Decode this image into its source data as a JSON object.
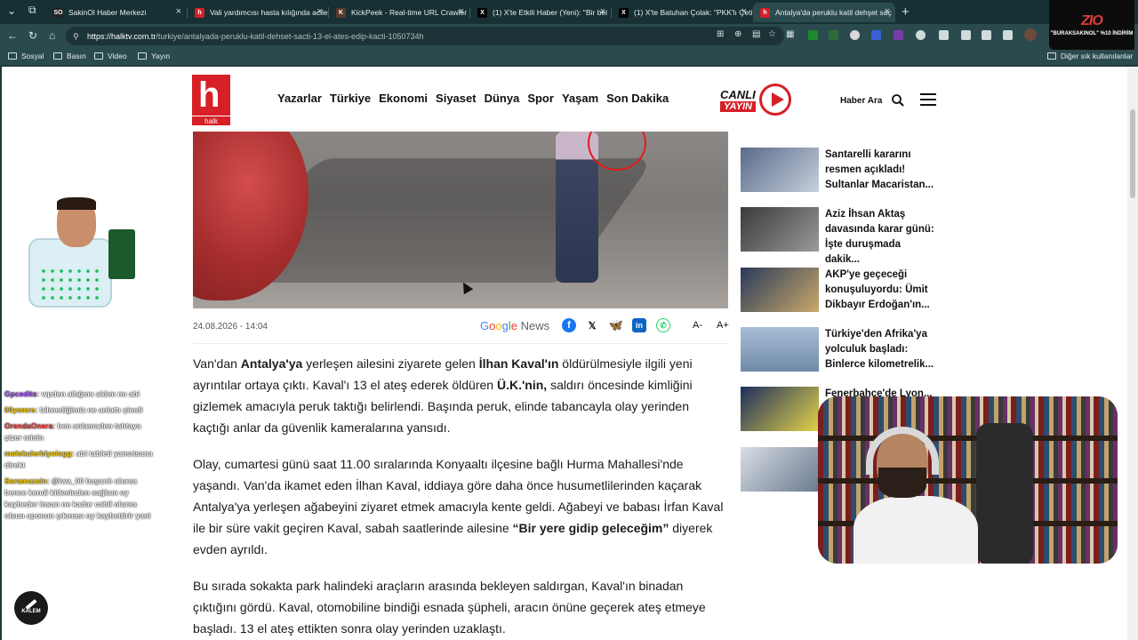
{
  "browser": {
    "tabs": [
      {
        "title": "SakinOl Haber Merkezi",
        "favicon": "SO",
        "color": "#222222"
      },
      {
        "title": "Vali yardımcısı hasta kılığında acile",
        "favicon": "h",
        "color": "#d61f26"
      },
      {
        "title": "KickPeek - Real-time URL Crawler",
        "favicon": "K",
        "color": "#5a3a2a"
      },
      {
        "title": "(1) X'te Etkili Haber (Yeni): \"Bir bel",
        "favicon": "X",
        "color": "#000000"
      },
      {
        "title": "(1) X'te Batuhan Çolak: \"PKK'lı Çeti",
        "favicon": "X",
        "color": "#000000"
      },
      {
        "title": "Antalya'da peruklu katil dehşet saç",
        "favicon": "h",
        "color": "#d61f26"
      }
    ],
    "url_host": "https://halktv.com.tr",
    "url_path": "/turkiye/antalyada-peruklu-katil-dehset-sacti-13-el-ates-edip-kacti-1050734h",
    "bookmarks": [
      "Sosyal",
      "Basın",
      "Video",
      "Yayın"
    ],
    "other_bookmarks": "Diğer sık kullanılanlar",
    "stream_badge_brand": "ZIO",
    "stream_badge_code": "\"BURAKSAKINOL\" %10 İNDİRİM"
  },
  "site": {
    "logo_letter": "h",
    "logo_sub": "halk",
    "nav": [
      "Yazarlar",
      "Türkiye",
      "Ekonomi",
      "Siyaset",
      "Dünya",
      "Spor",
      "Yaşam",
      "Son Dakika"
    ],
    "live_label_1": "CANLI",
    "live_label_2": "YAYIN",
    "search_label": "Haber Ara"
  },
  "article": {
    "date": "24.08.2026 - 14:04",
    "google_news_g": [
      "G",
      "o",
      "o",
      "g",
      "l",
      "e"
    ],
    "google_news_suffix": "News",
    "font_smaller": "A-",
    "font_larger": "A+",
    "p1_a": "Van'dan ",
    "p1_b": "Antalya'ya",
    "p1_c": " yerleşen ailesini ziyarete gelen ",
    "p1_d": "İlhan Kaval'ın",
    "p1_e": " öldürülmesiyle ilgili yeni ayrıntılar ortaya çıktı. Kaval'ı 13 el ateş ederek öldüren ",
    "p1_f": "Ü.K.'nin,",
    "p1_g": " saldırı öncesinde kimliğini gizlemek amacıyla peruk taktığı belirlendi. Başında peruk, elinde tabancayla olay yerinden kaçtığı anlar da güvenlik kameralarına yansıdı.",
    "p2_a": "Olay, cumartesi günü saat 11.00 sıralarında Konyaaltı ilçesine bağlı Hurma Mahallesi'nde yaşandı. Van'da ikamet eden İlhan Kaval, iddiaya göre daha önce husumetlilerinden kaçarak Antalya'ya yerleşen ağabeyini ziyaret etmek amacıyla kente geldi. Ağabeyi ve babası İrfan Kaval ile bir süre vakit geçiren Kaval, sabah saatlerinde ailesine ",
    "p2_b": "“Bir yere gidip geleceğim”",
    "p2_c": " diyerek evden ayrıldı.",
    "p3": "Bu sırada sokakta park halindeki araçların arasında bekleyen saldırgan, Kaval'ın binadan çıktığını gördü. Kaval, otomobiline bindiği esnada şüpheli, aracın önüne geçerek ateş etmeye başladı. 13 el ateş ettikten sonra olay yerinden uzaklaştı."
  },
  "sidebar": {
    "items": [
      {
        "title": "Santarelli kararını resmen açıkladı! Sultanlar Macaristan...",
        "thumb_color": "#5a6a8a"
      },
      {
        "title": "Aziz İhsan Aktaş davasında karar günü: İşte duruşmada dakik...",
        "thumb_color": "#4a4a4a"
      },
      {
        "title": "AKP'ye geçeceği konuşuluyordu: Ümit Dikbayır Erdoğan'ın...",
        "thumb_color": "#3a4a6a"
      },
      {
        "title": "Türkiye'den Afrika'ya yolculuk başladı: Binlerce kilometrelik...",
        "thumb_color": "#8aa0b8"
      },
      {
        "title": "Fenerbahçe'de Lyon...",
        "thumb_color": "#1c2f5c"
      },
      {
        "title": "",
        "thumb_color": "#7a8aa0"
      }
    ]
  },
  "chat": [
    {
      "user": "Gpcedits",
      "msg": " wpden altığımı aldım mı abi",
      "color_class": ""
    },
    {
      "user": "00yemre",
      "msg": " bilmediğimiz ne anlattı şimdi",
      "color_class": "y"
    },
    {
      "user": "OrendaOnera",
      "msg": " ben anlamadım tahtaya çizer misin",
      "color_class": "r"
    },
    {
      "user": "molekulerbiyologg",
      "msg": " abi tableti yansıtsana direkt",
      "color_class": "y"
    },
    {
      "user": "Soramazsin",
      "msg": " @iwa_00 başarılı olursa bence kendi kitlesinden sağlam oy kaybeder insan ne kadar cahil olursa olsun aponun çıkması oy kaybettirir yani",
      "color_class": "y"
    }
  ],
  "pen_button_label": "KALEM"
}
